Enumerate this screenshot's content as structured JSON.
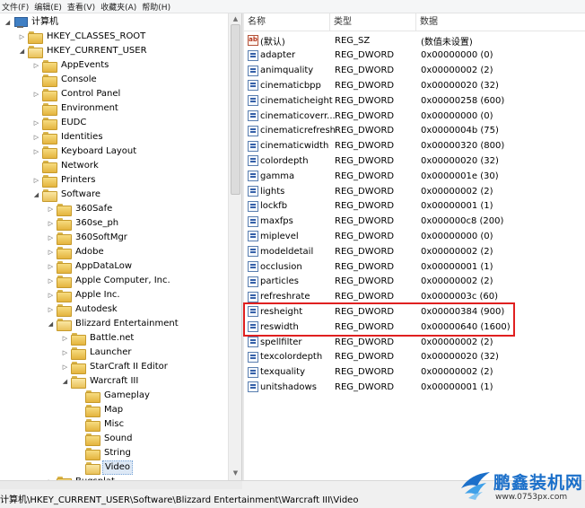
{
  "menu": [
    "文件(F)",
    "编辑(E)",
    "查看(V)",
    "收藏夹(A)",
    "帮助(H)"
  ],
  "tree": {
    "root": "计算机",
    "nodes": [
      {
        "label": "HKEY_CLASSES_ROOT",
        "level": 1,
        "state": "collapsed"
      },
      {
        "label": "HKEY_CURRENT_USER",
        "level": 1,
        "state": "expanded"
      },
      {
        "label": "AppEvents",
        "level": 2,
        "state": "collapsed"
      },
      {
        "label": "Console",
        "level": 2,
        "state": "leaf"
      },
      {
        "label": "Control Panel",
        "level": 2,
        "state": "collapsed"
      },
      {
        "label": "Environment",
        "level": 2,
        "state": "leaf"
      },
      {
        "label": "EUDC",
        "level": 2,
        "state": "collapsed"
      },
      {
        "label": "Identities",
        "level": 2,
        "state": "collapsed"
      },
      {
        "label": "Keyboard Layout",
        "level": 2,
        "state": "collapsed"
      },
      {
        "label": "Network",
        "level": 2,
        "state": "leaf"
      },
      {
        "label": "Printers",
        "level": 2,
        "state": "collapsed"
      },
      {
        "label": "Software",
        "level": 2,
        "state": "expanded"
      },
      {
        "label": "360Safe",
        "level": 3,
        "state": "collapsed"
      },
      {
        "label": "360se_ph",
        "level": 3,
        "state": "collapsed"
      },
      {
        "label": "360SoftMgr",
        "level": 3,
        "state": "collapsed"
      },
      {
        "label": "Adobe",
        "level": 3,
        "state": "collapsed"
      },
      {
        "label": "AppDataLow",
        "level": 3,
        "state": "collapsed"
      },
      {
        "label": "Apple Computer, Inc.",
        "level": 3,
        "state": "collapsed"
      },
      {
        "label": "Apple Inc.",
        "level": 3,
        "state": "collapsed"
      },
      {
        "label": "Autodesk",
        "level": 3,
        "state": "collapsed"
      },
      {
        "label": "Blizzard Entertainment",
        "level": 3,
        "state": "expanded"
      },
      {
        "label": "Battle.net",
        "level": 4,
        "state": "collapsed"
      },
      {
        "label": "Launcher",
        "level": 4,
        "state": "collapsed"
      },
      {
        "label": "StarCraft II Editor",
        "level": 4,
        "state": "collapsed"
      },
      {
        "label": "Warcraft III",
        "level": 4,
        "state": "expanded"
      },
      {
        "label": "Gameplay",
        "level": 5,
        "state": "leaf"
      },
      {
        "label": "Map",
        "level": 5,
        "state": "leaf"
      },
      {
        "label": "Misc",
        "level": 5,
        "state": "leaf"
      },
      {
        "label": "Sound",
        "level": 5,
        "state": "leaf"
      },
      {
        "label": "String",
        "level": 5,
        "state": "leaf"
      },
      {
        "label": "Video",
        "level": 5,
        "state": "leaf",
        "selected": true
      },
      {
        "label": "Bugsplat",
        "level": 3,
        "state": "collapsed"
      }
    ]
  },
  "list": {
    "headers": {
      "name": "名称",
      "type": "类型",
      "data": "数据"
    },
    "rows": [
      {
        "name": "(默认)",
        "type": "REG_SZ",
        "data": "(数值未设置)",
        "kind": "sz"
      },
      {
        "name": "adapter",
        "type": "REG_DWORD",
        "data": "0x00000000 (0)",
        "kind": "dword"
      },
      {
        "name": "animquality",
        "type": "REG_DWORD",
        "data": "0x00000002 (2)",
        "kind": "dword"
      },
      {
        "name": "cinematicbpp",
        "type": "REG_DWORD",
        "data": "0x00000020 (32)",
        "kind": "dword"
      },
      {
        "name": "cinematicheight",
        "type": "REG_DWORD",
        "data": "0x00000258 (600)",
        "kind": "dword"
      },
      {
        "name": "cinematicoverr...",
        "type": "REG_DWORD",
        "data": "0x00000000 (0)",
        "kind": "dword"
      },
      {
        "name": "cinematicrefresh",
        "type": "REG_DWORD",
        "data": "0x0000004b (75)",
        "kind": "dword"
      },
      {
        "name": "cinematicwidth",
        "type": "REG_DWORD",
        "data": "0x00000320 (800)",
        "kind": "dword"
      },
      {
        "name": "colordepth",
        "type": "REG_DWORD",
        "data": "0x00000020 (32)",
        "kind": "dword"
      },
      {
        "name": "gamma",
        "type": "REG_DWORD",
        "data": "0x0000001e (30)",
        "kind": "dword"
      },
      {
        "name": "lights",
        "type": "REG_DWORD",
        "data": "0x00000002 (2)",
        "kind": "dword"
      },
      {
        "name": "lockfb",
        "type": "REG_DWORD",
        "data": "0x00000001 (1)",
        "kind": "dword"
      },
      {
        "name": "maxfps",
        "type": "REG_DWORD",
        "data": "0x000000c8 (200)",
        "kind": "dword"
      },
      {
        "name": "miplevel",
        "type": "REG_DWORD",
        "data": "0x00000000 (0)",
        "kind": "dword"
      },
      {
        "name": "modeldetail",
        "type": "REG_DWORD",
        "data": "0x00000002 (2)",
        "kind": "dword"
      },
      {
        "name": "occlusion",
        "type": "REG_DWORD",
        "data": "0x00000001 (1)",
        "kind": "dword"
      },
      {
        "name": "particles",
        "type": "REG_DWORD",
        "data": "0x00000002 (2)",
        "kind": "dword"
      },
      {
        "name": "refreshrate",
        "type": "REG_DWORD",
        "data": "0x0000003c (60)",
        "kind": "dword"
      },
      {
        "name": "resheight",
        "type": "REG_DWORD",
        "data": "0x00000384 (900)",
        "kind": "dword"
      },
      {
        "name": "reswidth",
        "type": "REG_DWORD",
        "data": "0x00000640 (1600)",
        "kind": "dword"
      },
      {
        "name": "spellfilter",
        "type": "REG_DWORD",
        "data": "0x00000002 (2)",
        "kind": "dword"
      },
      {
        "name": "texcolordepth",
        "type": "REG_DWORD",
        "data": "0x00000020 (32)",
        "kind": "dword"
      },
      {
        "name": "texquality",
        "type": "REG_DWORD",
        "data": "0x00000002 (2)",
        "kind": "dword"
      },
      {
        "name": "unitshadows",
        "type": "REG_DWORD",
        "data": "0x00000001 (1)",
        "kind": "dword"
      }
    ]
  },
  "status_path": "计算机\\HKEY_CURRENT_USER\\Software\\Blizzard Entertainment\\Warcraft III\\Video",
  "watermark": {
    "title": "鹏鑫装机网",
    "url": "www.0753px.com"
  },
  "colors": {
    "highlight": "#e02020",
    "brand": "#1b6fc9"
  }
}
